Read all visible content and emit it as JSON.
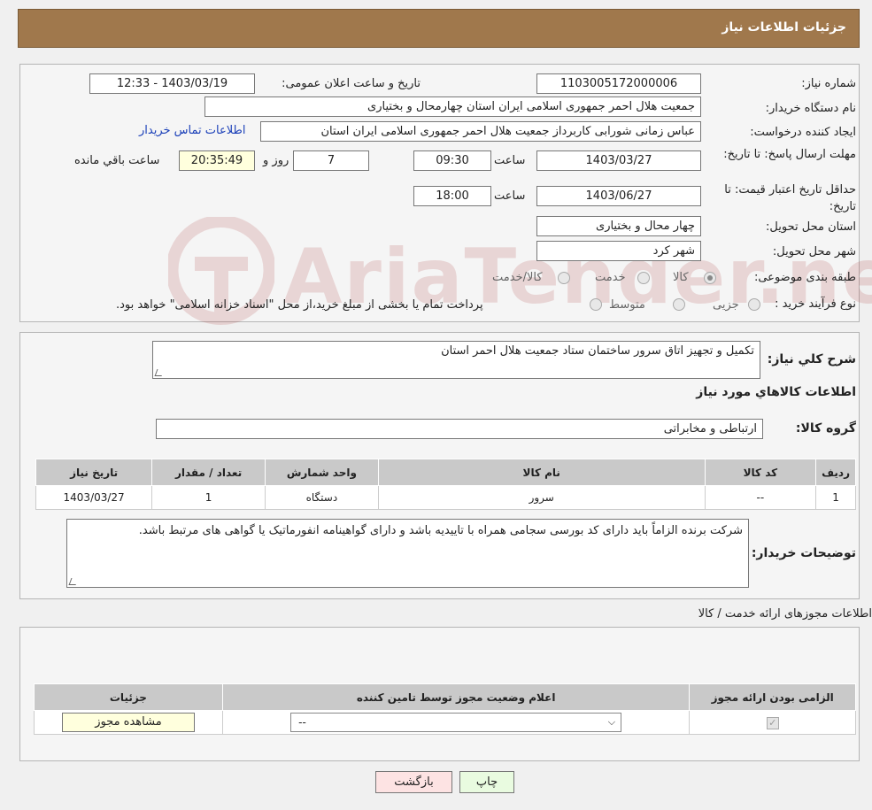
{
  "header": {
    "title": "جزئیات اطلاعات نیاز"
  },
  "form": {
    "need_number_label": "شماره نیاز:",
    "need_number": "1103005172000006",
    "announce_label": "تاریخ و ساعت اعلان عمومی:",
    "announce_value": "1403/03/19 - 12:33",
    "buyer_label": "نام دستگاه خریدار:",
    "buyer_value": "جمعیت هلال احمر جمهوری اسلامی ایران استان چهارمحال و بختیاری",
    "creator_label": "ایجاد کننده درخواست:",
    "creator_value": "عباس زمانی شورابی کاربرداز جمعیت هلال احمر جمهوری اسلامی ایران استان",
    "contact_link": "اطلاعات تماس خریدار",
    "deadline_label": "مهلت ارسال پاسخ: تا تاریخ:",
    "deadline_date": "1403/03/27",
    "time_label": "ساعت",
    "deadline_time": "09:30",
    "days_value": "7",
    "days_label": "روز و",
    "remaining_value": "20:35:49",
    "remaining_label": "ساعت باقي مانده",
    "validity_label": "حداقل تاریخ اعتبار قیمت: تا تاریخ:",
    "validity_date": "1403/06/27",
    "validity_time": "18:00",
    "province_label": "استان محل تحویل:",
    "province_value": "چهار محال و بختیاری",
    "city_label": "شهر محل تحویل:",
    "city_value": "شهر کرد",
    "category_label": "طبقه بندی موضوعی:",
    "category_options": [
      "کالا",
      "خدمت",
      "کالا/خدمت"
    ],
    "category_selected": "کالا",
    "process_label": "نوع فرآیند خرید :",
    "process_options": [
      "جزیی",
      "متوسط"
    ],
    "process_note": "پرداخت تمام یا بخشی از مبلغ خرید،از محل \"اسناد خزانه اسلامی\" خواهد بود."
  },
  "summary": {
    "desc_label": "شرح کلي نياز:",
    "desc_value": "تکمیل و تجهیز اتاق سرور ساختمان ستاد جمعیت هلال احمر استان",
    "goods_title": "اطلاعات کالاهاي مورد نياز",
    "group_label": "گروه کالا:",
    "group_value": "ارتباطی و مخابراتی",
    "table": {
      "headers": [
        "رديف",
        "کد کالا",
        "نام کالا",
        "واحد شمارش",
        "تعداد / مقدار",
        "تاريخ نياز"
      ],
      "rows": [
        [
          "1",
          "--",
          "سرور",
          "دستگاه",
          "1",
          "1403/03/27"
        ]
      ]
    },
    "buyer_notes_label": "توضیحات خریدار:",
    "buyer_notes": "شرکت برنده الزاماً باید دارای کد بورسی سجامی همراه با تاییدیه باشد و دارای گواهینامه انفورماتیک یا گواهی های مرتبط باشد."
  },
  "permits": {
    "title": "اطلاعات مجوزهای ارائه خدمت / کالا",
    "headers": [
      "الزامی بودن ارائه مجوز",
      "اعلام وضعیت مجوز توسط تامین کننده",
      "جزئیات"
    ],
    "select_value": "--",
    "view_button": "مشاهده مجوز"
  },
  "footer": {
    "print_button": "چاپ",
    "back_button": "بازگشت"
  },
  "watermark": "AriaTender.neT"
}
